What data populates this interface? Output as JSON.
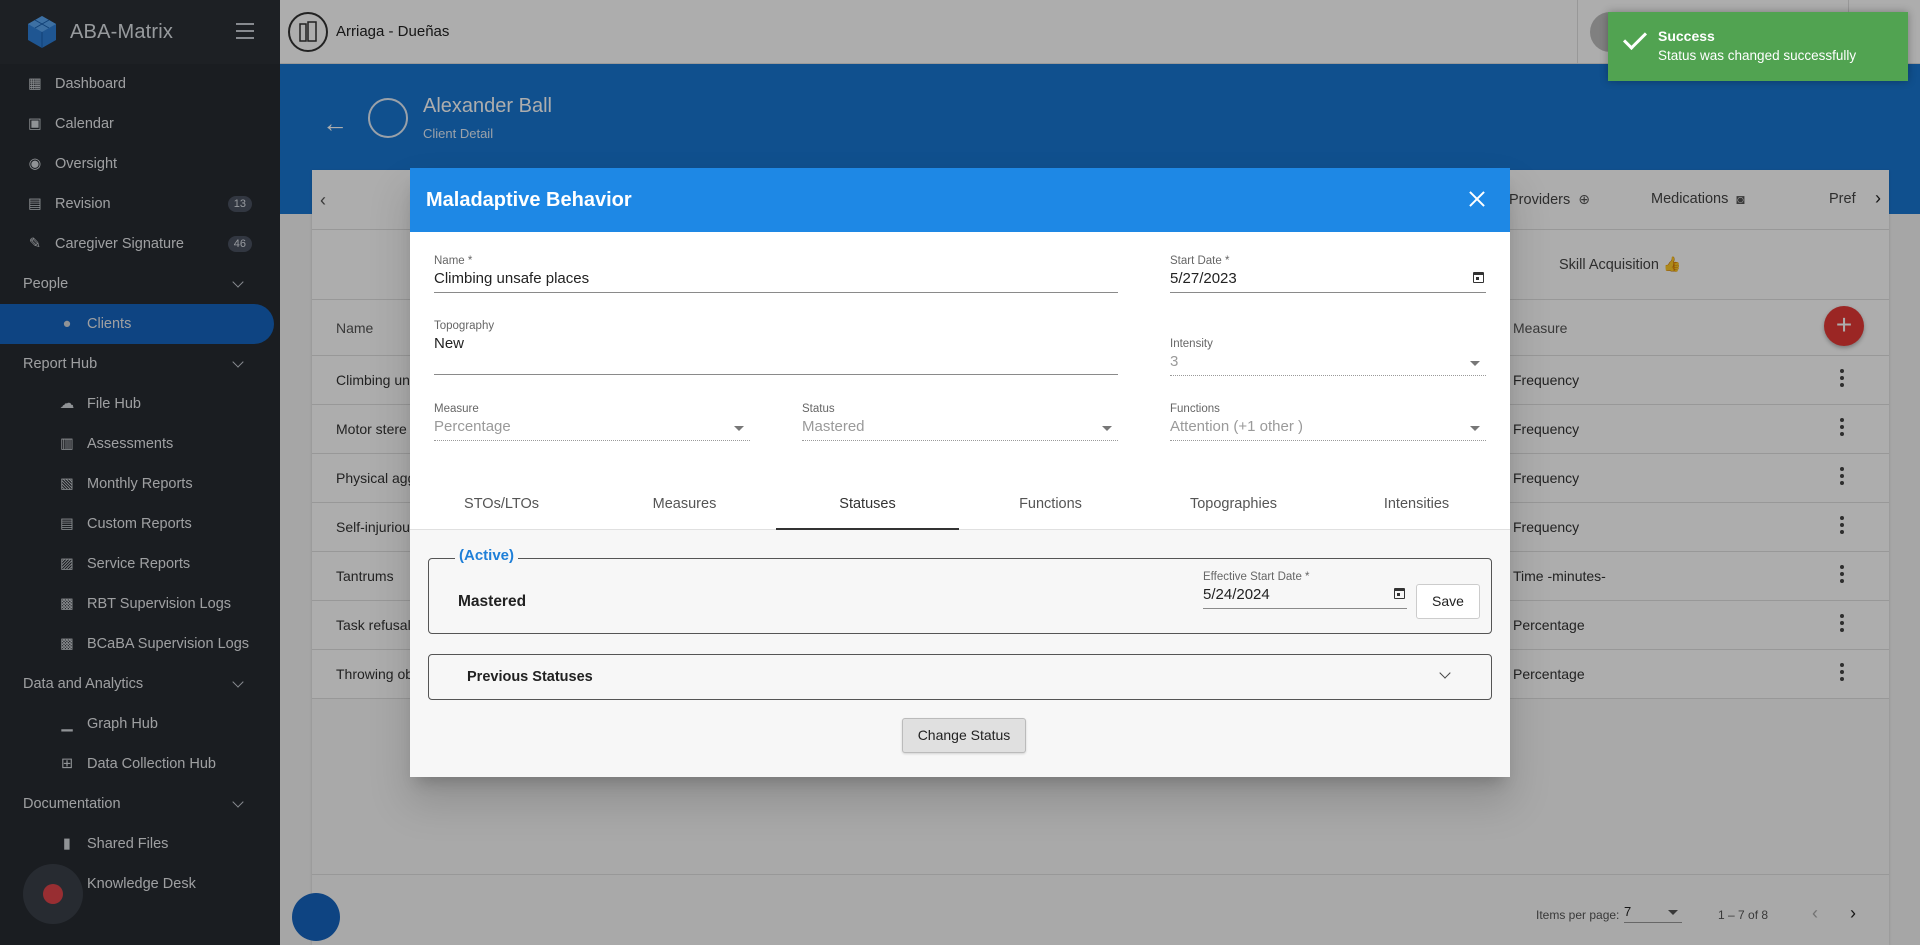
{
  "sidebar": {
    "app_name": "ABA-Matrix",
    "items": [
      {
        "label": "Dashboard",
        "icon": "dashboard-icon"
      },
      {
        "label": "Calendar",
        "icon": "calendar-icon"
      },
      {
        "label": "Oversight",
        "icon": "eye-icon"
      },
      {
        "label": "Revision",
        "icon": "revision-icon",
        "badge": "13"
      },
      {
        "label": "Caregiver Signature",
        "icon": "signature-icon",
        "badge": "46"
      }
    ],
    "sections": {
      "people": {
        "label": "People",
        "items": [
          {
            "label": "Clients",
            "icon": "person-icon"
          }
        ]
      },
      "report_hub": {
        "label": "Report Hub",
        "items": [
          {
            "label": "File Hub",
            "icon": "cloud-icon"
          },
          {
            "label": "Assessments",
            "icon": "assessment-icon"
          },
          {
            "label": "Monthly Reports",
            "icon": "report-icon"
          },
          {
            "label": "Custom Reports",
            "icon": "report-icon"
          },
          {
            "label": "Service Reports",
            "icon": "report-icon"
          },
          {
            "label": "RBT Supervision Logs",
            "icon": "log-icon"
          },
          {
            "label": "BCaBA Supervision Logs",
            "icon": "log-icon"
          }
        ]
      },
      "data_analytics": {
        "label": "Data and Analytics",
        "items": [
          {
            "label": "Graph Hub",
            "icon": "graph-icon"
          },
          {
            "label": "Data Collection Hub",
            "icon": "data-icon"
          }
        ]
      },
      "documentation": {
        "label": "Documentation",
        "items": [
          {
            "label": "Shared Files",
            "icon": "files-icon"
          },
          {
            "label": "Knowledge Desk",
            "icon": "book-icon"
          }
        ]
      }
    }
  },
  "topbar": {
    "org_name": "Arriaga - Dueñas"
  },
  "client": {
    "name": "Alexander Ball",
    "subtitle": "Client Detail"
  },
  "client_tabs": [
    "Providers",
    "Medications",
    "Pref"
  ],
  "subtab": {
    "label": "Skill Acquisition"
  },
  "table": {
    "headers": {
      "name": "Name",
      "measure": "Measure"
    },
    "rows": [
      {
        "name": "Climbing un",
        "measure": "Frequency"
      },
      {
        "name": "Motor stere",
        "measure": "Frequency"
      },
      {
        "name": "Physical agg",
        "measure": "Frequency"
      },
      {
        "name": "Self-injuriou",
        "measure": "Frequency"
      },
      {
        "name": "Tantrums",
        "measure": "Time -minutes-"
      },
      {
        "name": "Task refusal",
        "measure": "Percentage"
      },
      {
        "name": "Throwing ob",
        "measure": "Percentage"
      }
    ]
  },
  "paginator": {
    "label": "Items per page:",
    "per_page": "7",
    "range": "1 – 7 of 8"
  },
  "toast": {
    "title": "Success",
    "message": "Status was changed successfully",
    "color": "#51a351"
  },
  "dialog": {
    "title": "Maladaptive Behavior",
    "fields": {
      "name": {
        "label": "Name *",
        "value": "Climbing unsafe places"
      },
      "start_date": {
        "label": "Start Date *",
        "value": "5/27/2023"
      },
      "topography": {
        "label": "Topography",
        "value": "New"
      },
      "intensity": {
        "label": "Intensity",
        "value": "3"
      },
      "measure": {
        "label": "Measure",
        "value": "Percentage"
      },
      "status": {
        "label": "Status",
        "value": "Mastered"
      },
      "functions": {
        "label": "Functions",
        "value": "Attention (+1 other )"
      }
    },
    "tabs": [
      "STOs/LTOs",
      "Measures",
      "Statuses",
      "Functions",
      "Topographies",
      "Intensities"
    ],
    "active_tab": "Statuses",
    "current_status": {
      "legend": "(Active)",
      "name": "Mastered",
      "effective_label": "Effective Start Date *",
      "effective_value": "5/24/2024",
      "save_label": "Save"
    },
    "previous_label": "Previous Statuses",
    "change_label": "Change Status",
    "header_color": "#1e88e5"
  }
}
